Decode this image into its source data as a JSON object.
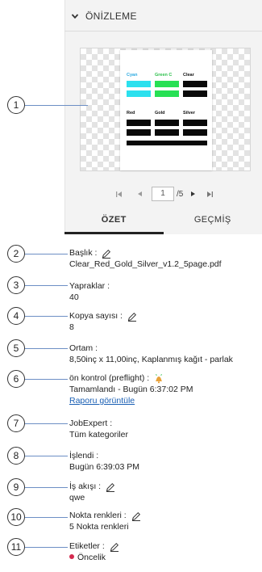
{
  "preview": {
    "header": "ÖNİZLEME",
    "swatches": [
      {
        "title": "Cyan",
        "title_color": "#2aa9e0",
        "bar_color": "#2ce0ee"
      },
      {
        "title": "Green C",
        "title_color": "#2bbf4a",
        "bar_color": "#27e054"
      },
      {
        "title": "Clear",
        "title_color": "#111111",
        "bar_color": "#0a0a0a"
      },
      {
        "title": "Red",
        "title_color": "#111111",
        "bar_color": "#0a0a0a"
      },
      {
        "title": "Gold",
        "title_color": "#111111",
        "bar_color": "#0a0a0a"
      },
      {
        "title": "Silver",
        "title_color": "#111111",
        "bar_color": "#0a0a0a"
      }
    ],
    "pager": {
      "current": "1",
      "total": "/5"
    }
  },
  "tabs": [
    {
      "label": "ÖZET",
      "active": true
    },
    {
      "label": "GEÇMİŞ",
      "active": false
    }
  ],
  "callouts": [
    "1",
    "2",
    "3",
    "4",
    "5",
    "6",
    "7",
    "8",
    "9",
    "10",
    "11"
  ],
  "fields": {
    "title": {
      "label": "Başlık :",
      "value": "Clear_Red_Gold_Silver_v1.2_5page.pdf"
    },
    "pages": {
      "label": "Yapraklar :",
      "value": "40"
    },
    "copies": {
      "label": "Kopya sayısı :",
      "value": "8"
    },
    "media": {
      "label": "Ortam :",
      "value": "8,50inç x 11,00inç, Kaplanmış kağıt - parlak"
    },
    "preflight": {
      "label": "ön kontrol (preflight) :",
      "value": "Tamamlandı - Bugün 6:37:02 PM",
      "link": "Raporu görüntüle"
    },
    "jobexpert": {
      "label": "JobExpert :",
      "value": "Tüm kategoriler"
    },
    "processed": {
      "label": "İşlendi :",
      "value": "Bugün 6:39:03 PM"
    },
    "workflow": {
      "label": "İş akışı :",
      "value": "qwe"
    },
    "spot": {
      "label": "Nokta renkleri :",
      "value": "5 Nokta renkleri"
    },
    "tags": {
      "label": "Etiketler :",
      "value": "Öncelik",
      "dot_color": "#d42a4f"
    }
  },
  "colors": {
    "accent_link": "#1a5fb4",
    "leader_line": "#6d8fc5",
    "warning_icon": "#e8a23a"
  }
}
